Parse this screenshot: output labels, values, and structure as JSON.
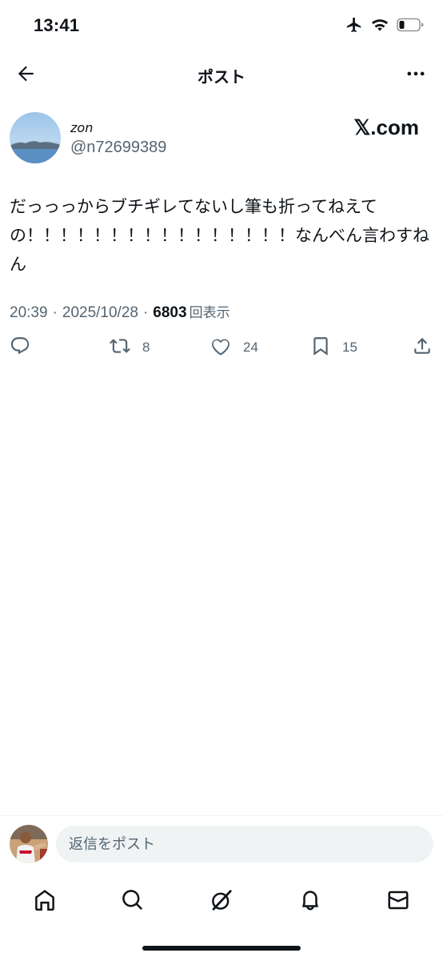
{
  "status_bar": {
    "time": "13:41",
    "icons": [
      "airplane-icon",
      "wifi-icon",
      "battery-icon"
    ]
  },
  "header": {
    "title": "ポスト",
    "back_icon": "arrow-left-icon",
    "more_icon": "more-horizontal-icon"
  },
  "post": {
    "display_name": "zon",
    "handle": "@n72699389",
    "source_badge": "𝕏.com",
    "text": "だっっっからブチギレてないし筆も折ってねえての！！！！！！！！！！！！！！！！なんべん言わすねん",
    "time": "20:39",
    "date": "2025/10/28",
    "views_count": "6803",
    "views_label": "回表示",
    "separator": "·"
  },
  "actions": {
    "reply": {
      "icon": "reply-icon",
      "count": ""
    },
    "repost": {
      "icon": "repost-icon",
      "count": "8"
    },
    "like": {
      "icon": "heart-icon",
      "count": "24"
    },
    "bookmark": {
      "icon": "bookmark-icon",
      "count": "15"
    },
    "share": {
      "icon": "share-icon"
    }
  },
  "reply_bar": {
    "placeholder": "返信をポスト"
  },
  "tab_bar": {
    "items": [
      "home-icon",
      "search-icon",
      "grok-icon",
      "notifications-icon",
      "messages-icon"
    ]
  },
  "colors": {
    "text": "#0f1419",
    "secondary": "#536471",
    "input_bg": "#eff3f4"
  }
}
